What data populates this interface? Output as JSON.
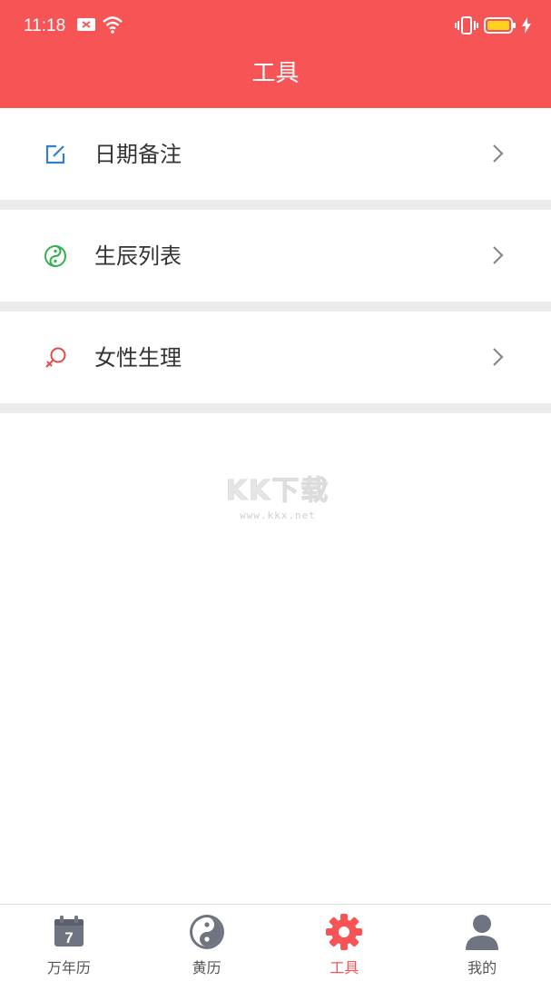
{
  "status_bar": {
    "time": "11:18"
  },
  "header": {
    "title": "工具"
  },
  "menu": {
    "items": [
      {
        "label": "日期备注",
        "icon": "edit-note-icon",
        "icon_color": "#2f7fd2"
      },
      {
        "label": "生辰列表",
        "icon": "yin-yang-icon",
        "icon_color": "#2db24a"
      },
      {
        "label": "女性生理",
        "icon": "female-symbol-icon",
        "icon_color": "#e34b4b"
      }
    ]
  },
  "watermark": {
    "logo": "KK下载",
    "url": "www.kkx.net"
  },
  "tabbar": {
    "tabs": [
      {
        "label": "万年历",
        "icon": "calendar-icon",
        "active": false
      },
      {
        "label": "黄历",
        "icon": "yin-yang-icon",
        "active": false
      },
      {
        "label": "工具",
        "icon": "gear-icon",
        "active": true
      },
      {
        "label": "我的",
        "icon": "user-icon",
        "active": false
      }
    ],
    "calendar_day": "7"
  },
  "colors": {
    "accent": "#f65455",
    "inactive_icon": "#6e7480",
    "divider": "#ececec"
  }
}
